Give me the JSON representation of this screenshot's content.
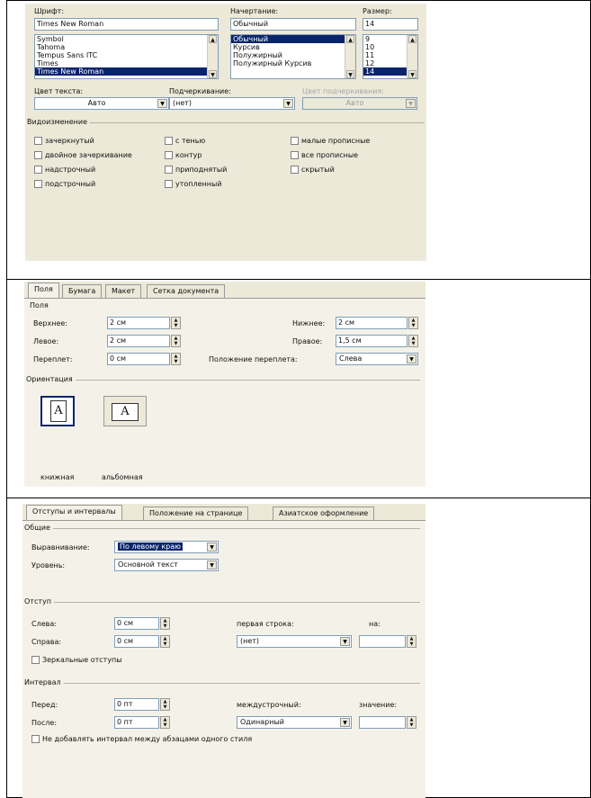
{
  "font_dialog": {
    "font_label": "Шрифт:",
    "font_value": "Times New Roman",
    "font_list": [
      "Symbol",
      "Tahoma",
      "Tempus Sans ITC",
      "Times",
      "Times New Roman"
    ],
    "style_label": "Начертание:",
    "style_value": "Обычный",
    "style_list": [
      "Обычный",
      "Курсив",
      "Полужирный",
      "Полужирный Курсив"
    ],
    "size_label": "Размер:",
    "size_value": "14",
    "size_list": [
      "9",
      "10",
      "11",
      "12",
      "14"
    ],
    "text_color_label": "Цвет текста:",
    "text_color_value": "Авто",
    "underline_label": "Подчеркивание:",
    "underline_value": "(нет)",
    "underline_color_label": "Цвет подчеркивания:",
    "underline_color_value": "Авто",
    "effects_label": "Видоизменение",
    "effects": {
      "strike": "зачеркнутый",
      "double_strike": "двойное зачеркивание",
      "superscript": "надстрочный",
      "subscript": "подстрочный",
      "shadow": "с тенью",
      "outline": "контур",
      "emboss": "приподнятый",
      "engrave": "утопленный",
      "small_caps": "малые прописные",
      "all_caps": "все прописные",
      "hidden": "скрытый"
    }
  },
  "page_dialog": {
    "tabs": [
      "Поля",
      "Бумага",
      "Макет",
      "Сетка документа"
    ],
    "margins_label": "Поля",
    "top_label": "Верхнее:",
    "top_value": "2 см",
    "bottom_label": "Нижнее:",
    "bottom_value": "2 см",
    "left_label": "Левое:",
    "left_value": "2 см",
    "right_label": "Правое:",
    "right_value": "1,5 см",
    "gutter_label": "Переплет:",
    "gutter_value": "0 см",
    "gutter_pos_label": "Положение переплета:",
    "gutter_pos_value": "Слева",
    "orientation_label": "Ориентация",
    "portrait_label": "книжная",
    "landscape_label": "альбомная",
    "glyph": "A"
  },
  "paragraph_dialog": {
    "tabs": [
      "Отступы и интервалы",
      "Положение на странице",
      "Азиатское оформление"
    ],
    "general_label": "Общие",
    "alignment_label": "Выравнивание:",
    "alignment_value": "По левому краю",
    "level_label": "Уровень:",
    "level_value": "Основной текст",
    "indent_label": "Отступ",
    "left_label": "Слева:",
    "left_value": "0 см",
    "right_label": "Справа:",
    "right_value": "0 см",
    "first_line_label": "первая строка:",
    "first_line_value": "(нет)",
    "by_label": "на:",
    "mirror_label": "Зеркальные отступы",
    "spacing_label": "Интервал",
    "before_label": "Перед:",
    "before_value": "0 пт",
    "after_label": "После:",
    "after_value": "0 пт",
    "line_spacing_label": "междустрочный:",
    "line_spacing_value": "Одинарный",
    "value_label": "значение:",
    "dont_add_label": "Не добавлять интервал между абзацами одного стиля"
  }
}
